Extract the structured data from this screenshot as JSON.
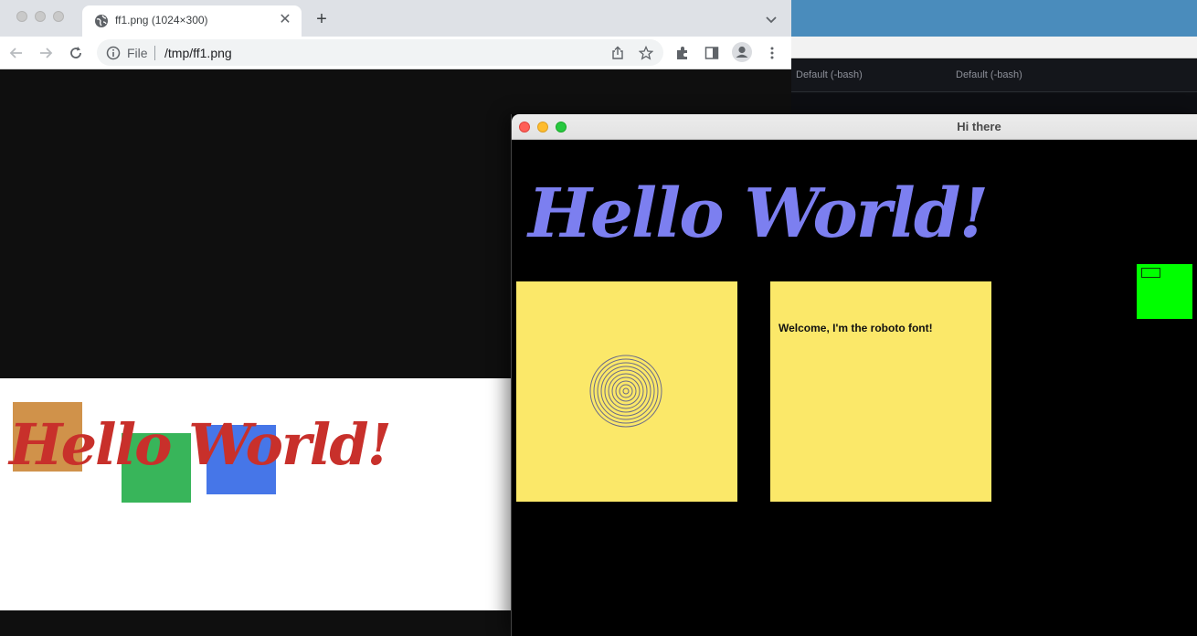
{
  "terminal": {
    "tabs": [
      "Default (-bash)",
      "Default (-bash)"
    ]
  },
  "browser": {
    "tab": {
      "title": "ff1.png (1024×300)",
      "close_glyph": "✕",
      "favicon": "globe-icon"
    },
    "new_tab_glyph": "+",
    "address": {
      "scheme_label": "File",
      "url": "/tmp/ff1.png"
    },
    "toolbar_icons": [
      "back-arrow-icon",
      "forward-arrow-icon",
      "reload-icon",
      "info-icon",
      "share-icon",
      "star-icon",
      "extensions-icon",
      "side-panel-icon",
      "profile-icon",
      "more-icon"
    ],
    "image": {
      "text": "Hello World!",
      "text_color": "#c8302b",
      "squares": [
        {
          "name": "orange",
          "color": "#d0924a"
        },
        {
          "name": "green",
          "color": "#38b55a"
        },
        {
          "name": "blue",
          "color": "#4676e8"
        }
      ]
    }
  },
  "app_window": {
    "title": "Hi there",
    "heading": "Hello World!",
    "heading_color": "#7c7ff0",
    "panel_color": "#fbe869",
    "welcome_text": "Welcome, I'm the roboto font!",
    "indicator_color": "#00ff00"
  }
}
